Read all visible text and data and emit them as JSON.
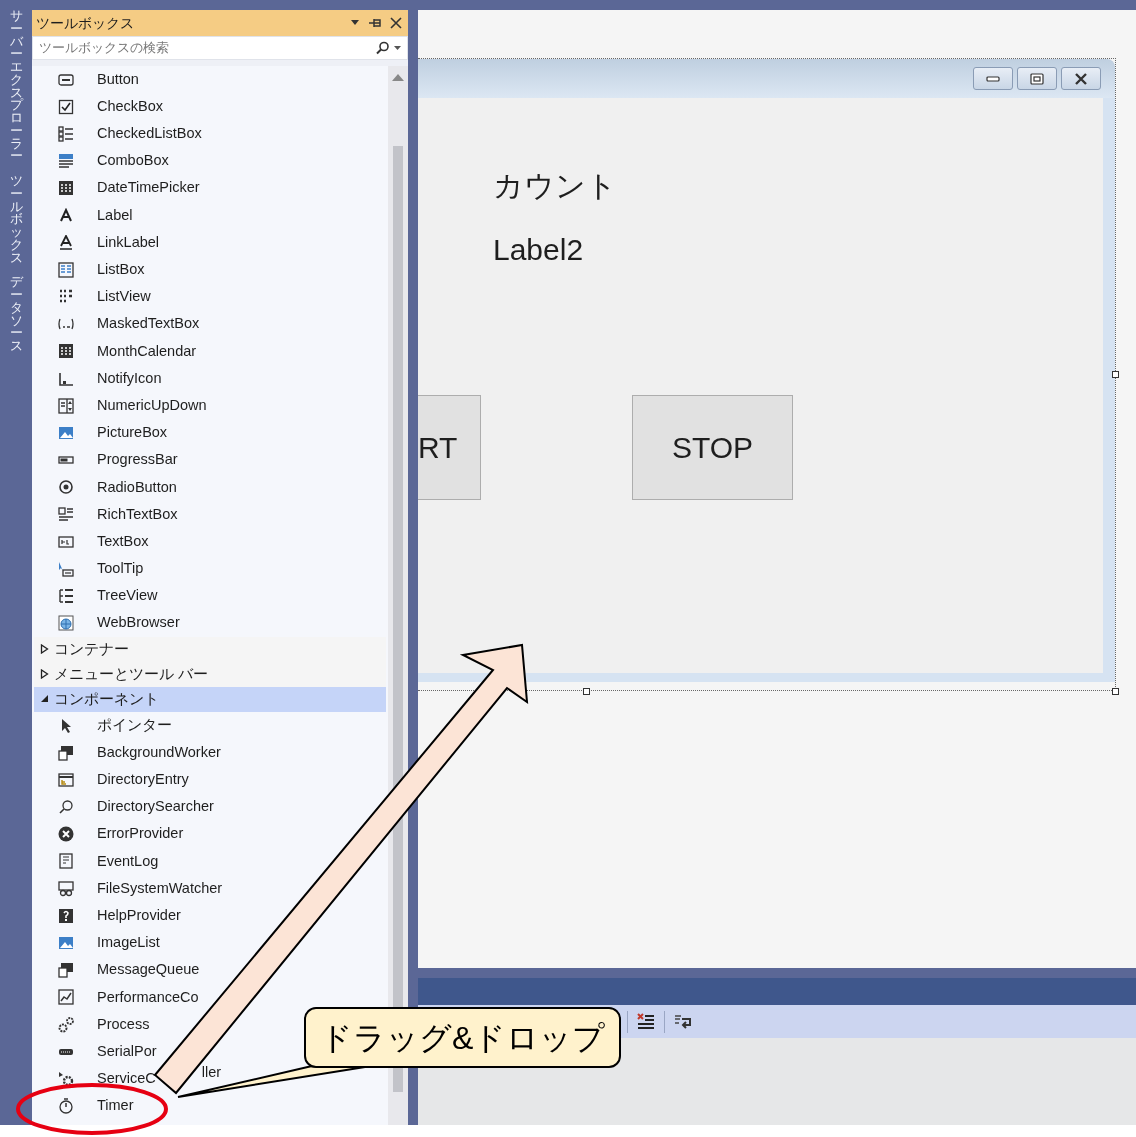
{
  "side_tabs": [
    {
      "label": "サーバーエクスプローラー"
    },
    {
      "label": "ツールボックス"
    },
    {
      "label": "データソース"
    }
  ],
  "toolbox": {
    "title": "ツールボックス",
    "search": {
      "placeholder": "ツールボックスの検索"
    },
    "tools": [
      {
        "label": "Button"
      },
      {
        "label": "CheckBox"
      },
      {
        "label": "CheckedListBox"
      },
      {
        "label": "ComboBox"
      },
      {
        "label": "DateTimePicker"
      },
      {
        "label": "Label"
      },
      {
        "label": "LinkLabel"
      },
      {
        "label": "ListBox"
      },
      {
        "label": "ListView"
      },
      {
        "label": "MaskedTextBox"
      },
      {
        "label": "MonthCalendar"
      },
      {
        "label": "NotifyIcon"
      },
      {
        "label": "NumericUpDown"
      },
      {
        "label": "PictureBox"
      },
      {
        "label": "ProgressBar"
      },
      {
        "label": "RadioButton"
      },
      {
        "label": "RichTextBox"
      },
      {
        "label": "TextBox"
      },
      {
        "label": "ToolTip"
      },
      {
        "label": "TreeView"
      },
      {
        "label": "WebBrowser"
      }
    ],
    "categories": [
      {
        "label": "コンテナー",
        "expanded": false,
        "selected": false
      },
      {
        "label": "メニューとツール バー",
        "expanded": false,
        "selected": false
      },
      {
        "label": "コンポーネント",
        "expanded": true,
        "selected": true,
        "children": [
          {
            "label": "ポインター"
          },
          {
            "label": "BackgroundWorker"
          },
          {
            "label": "DirectoryEntry"
          },
          {
            "label": "DirectorySearcher"
          },
          {
            "label": "ErrorProvider"
          },
          {
            "label": "EventLog"
          },
          {
            "label": "FileSystemWatcher"
          },
          {
            "label": "HelpProvider"
          },
          {
            "label": "ImageList"
          },
          {
            "label": "MessageQueue"
          },
          {
            "label": "PerformanceCo"
          },
          {
            "label": "Process"
          },
          {
            "label": "SerialPor"
          },
          {
            "label": "ServiceC",
            "label_tail": "ller"
          },
          {
            "label": "Timer"
          }
        ]
      }
    ]
  },
  "form": {
    "labels": [
      "カウント",
      "Label2"
    ],
    "buttons": [
      "RT",
      "STOP"
    ]
  },
  "callout": {
    "text": "ドラッグ&ドロップ"
  }
}
